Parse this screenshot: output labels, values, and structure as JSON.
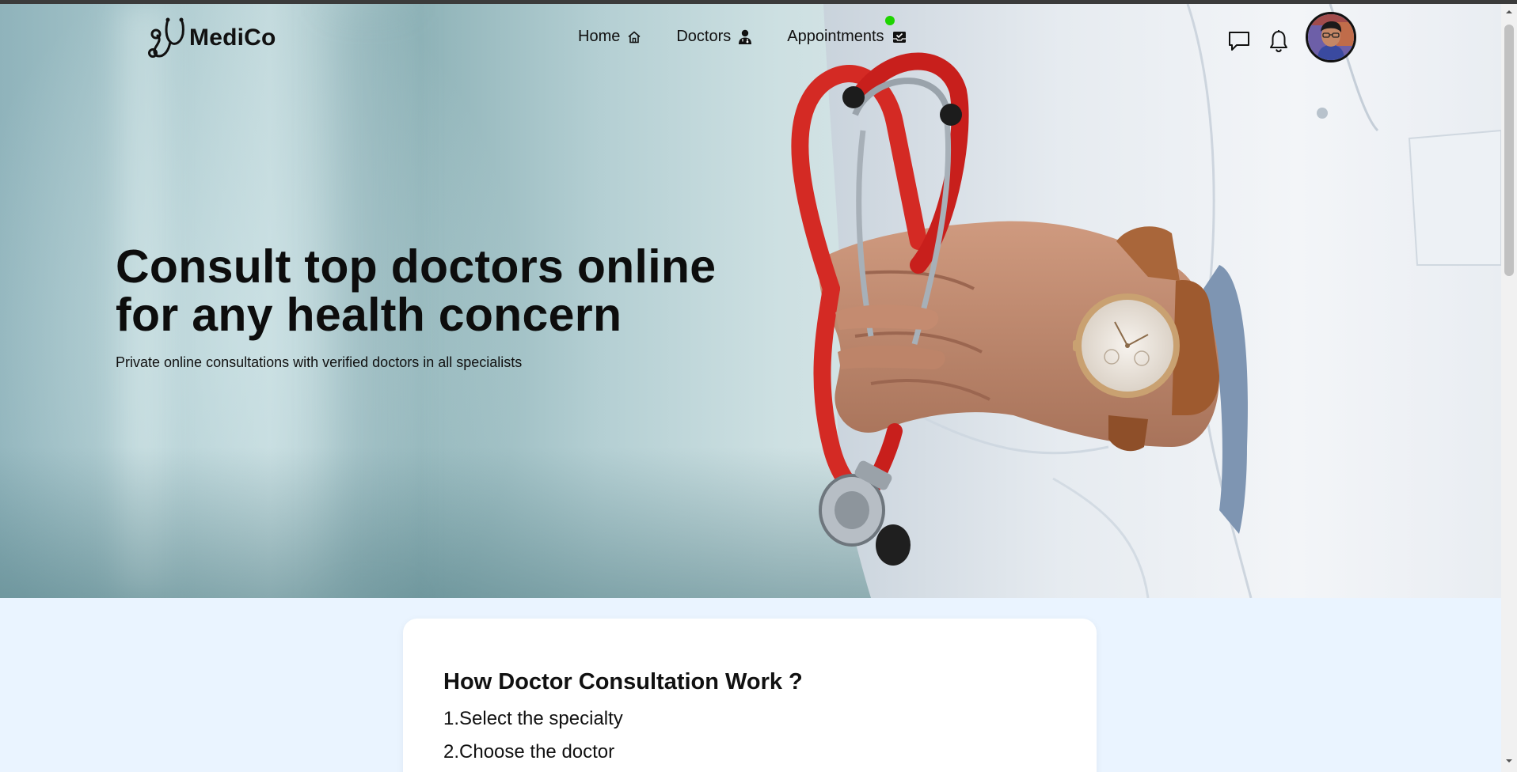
{
  "brand": {
    "name": "MediCo"
  },
  "nav": {
    "home": "Home",
    "doctors": "Doctors",
    "appointments": "Appointments"
  },
  "header_icons": [
    "chat-icon",
    "bell-icon",
    "avatar"
  ],
  "hero": {
    "title_line1": "Consult top doctors online",
    "title_line2": "for any health concern",
    "subtitle": "Private online consultations with verified doctors in all specialists"
  },
  "how_it_works": {
    "title": "How Doctor Consultation Work ?",
    "steps": [
      "1.Select the specialty",
      "2.Choose the doctor"
    ]
  },
  "colors": {
    "online_indicator": "#1ed400",
    "section_background": "#eaf4ff",
    "stethoscope_red": "#d42a24"
  }
}
